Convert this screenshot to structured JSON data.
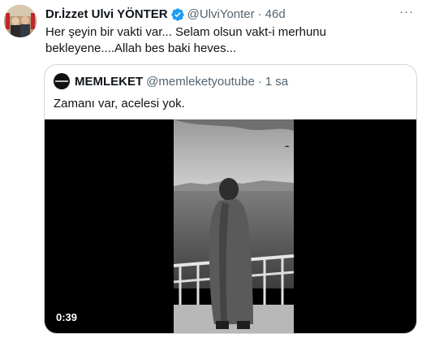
{
  "tweet": {
    "display_name": "Dr.İzzet Ulvi YÖNTER",
    "handle": "@UlviYonter",
    "separator": "·",
    "time": "46d",
    "text": "Her şeyin bir vakti var... Selam olsun vakt-i merhunu bekleyene....Allah bes baki heves...",
    "more_label": "···",
    "verified_color": "#1d9bf0"
  },
  "quote": {
    "display_name": "MEMLEKET",
    "handle": "@memleketyoutube",
    "separator": "·",
    "time": "1 sa",
    "text": "Zamanı var, acelesi yok.",
    "video": {
      "duration": "0:39"
    }
  }
}
